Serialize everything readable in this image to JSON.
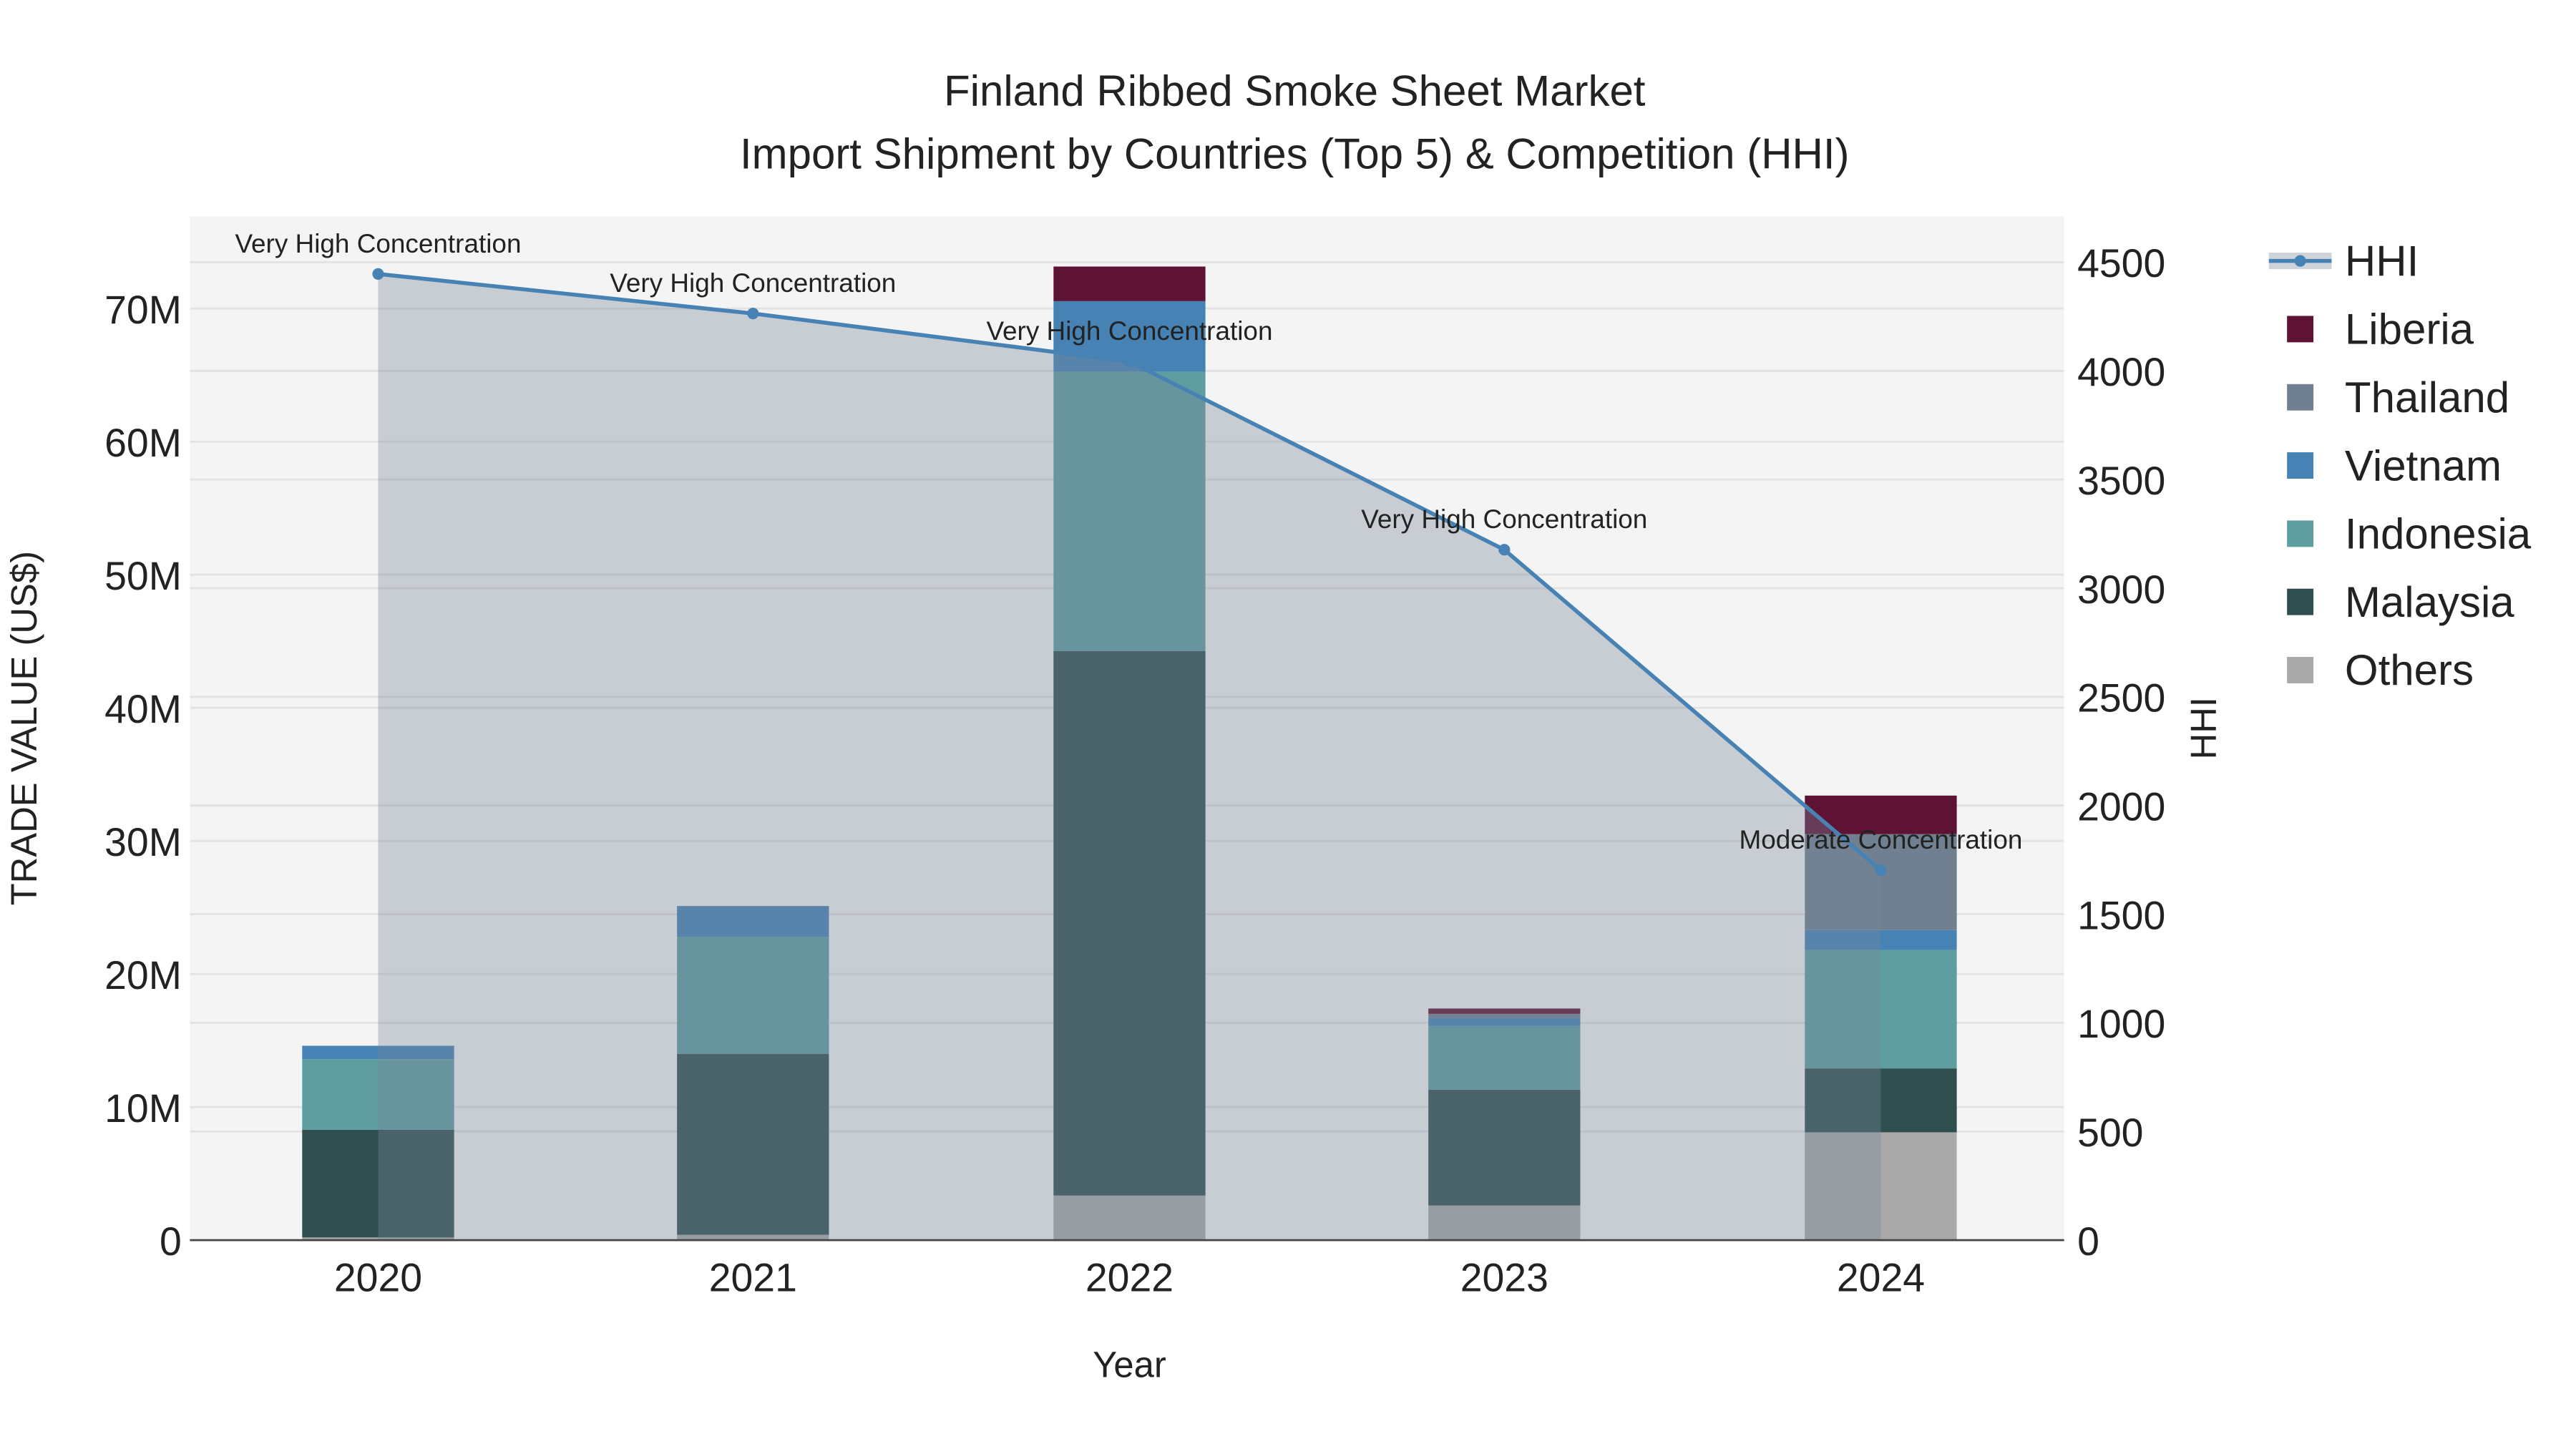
{
  "chart_data": {
    "type": "bar",
    "title": "Finland Ribbed Smoke Sheet Market",
    "subtitle": "Import Shipment by Countries (Top 5) & Competition (HHI)",
    "xlabel": "Year",
    "ylabel": "TRADE VALUE (US$)",
    "y2label": "HHI",
    "categories": [
      "2020",
      "2021",
      "2022",
      "2023",
      "2024"
    ],
    "ylim": [
      0,
      75000000
    ],
    "y2lim": [
      0,
      4700
    ],
    "yticks": [
      0,
      10000000,
      20000000,
      30000000,
      40000000,
      50000000,
      60000000,
      70000000
    ],
    "ytick_labels": [
      "0",
      "10M",
      "20M",
      "30M",
      "40M",
      "50M",
      "60M",
      "70M"
    ],
    "y2ticks": [
      0,
      500,
      1000,
      1500,
      2000,
      2500,
      3000,
      3500,
      4000,
      4500
    ],
    "y2tick_labels": [
      "0",
      "500",
      "1000",
      "1500",
      "2000",
      "2500",
      "3000",
      "3500",
      "4000",
      "4500"
    ],
    "grid": true,
    "legend_position": "right",
    "stacked": true,
    "series": [
      {
        "name": "Others",
        "color": "#a9a9a9",
        "values": [
          200000,
          400000,
          3350000,
          2600000,
          8100000
        ]
      },
      {
        "name": "Malaysia",
        "color": "#2f4f4f",
        "values": [
          8100000,
          13600000,
          40900000,
          8700000,
          4800000
        ]
      },
      {
        "name": "Indonesia",
        "color": "#5f9ea0",
        "values": [
          5300000,
          8800000,
          21000000,
          4800000,
          8900000
        ]
      },
      {
        "name": "Vietnam",
        "color": "#4682b4",
        "values": [
          1000000,
          2300000,
          5300000,
          600000,
          1500000
        ]
      },
      {
        "name": "Thailand",
        "color": "#708090",
        "values": [
          0,
          0,
          0,
          300000,
          7200000
        ]
      },
      {
        "name": "Liberia",
        "color": "#5e1234",
        "values": [
          0,
          0,
          2600000,
          400000,
          2900000
        ]
      }
    ],
    "hhi": {
      "name": "HHI",
      "color": "#4682b4",
      "values": [
        4446,
        4264,
        4043,
        3177,
        1702
      ],
      "annotations": [
        "Very High Concentration",
        "Very High Concentration",
        "Very High Concentration",
        "Very High Concentration",
        "Moderate Concentration"
      ]
    },
    "legend": [
      "HHI",
      "Liberia",
      "Thailand",
      "Vietnam",
      "Indonesia",
      "Malaysia",
      "Others"
    ]
  }
}
